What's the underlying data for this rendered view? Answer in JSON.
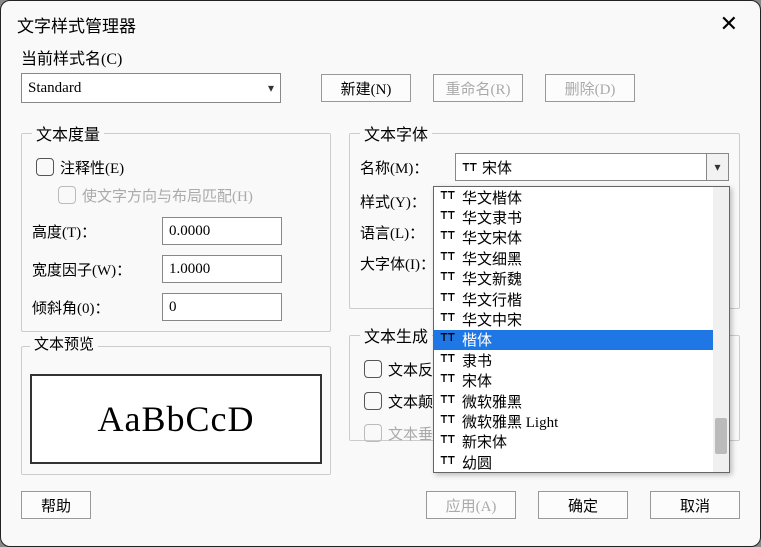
{
  "window": {
    "title": "文字样式管理器"
  },
  "currentStyle": {
    "label": "当前样式名(C)",
    "value": "Standard"
  },
  "topButtons": {
    "new": "新建(N)",
    "rename": "重命名(R)",
    "delete": "删除(D)"
  },
  "metrics": {
    "legend": "文本度量",
    "annotative": "注释性(E)",
    "matchOrientation": "使文字方向与布局匹配(H)",
    "heightLabel": "高度(T)：",
    "heightValue": "0.0000",
    "widthLabel": "宽度因子(W)：",
    "widthValue": "1.0000",
    "obliqueLabel": "倾斜角(0)：",
    "obliqueValue": "0"
  },
  "font": {
    "legend": "文本字体",
    "nameLabel": "名称(M)：",
    "nameValue": "宋体",
    "styleLabel": "样式(Y)：",
    "langLabel": "语言(L)：",
    "bigFontLabel": "大字体(I)："
  },
  "preview": {
    "legend": "文本预览",
    "sample": "AaBbCcD"
  },
  "gen": {
    "legend": "文本生成",
    "backwards": "文本反向",
    "upsidedown": "文本颠倒",
    "vertical": "文本垂直"
  },
  "footer": {
    "help": "帮助",
    "apply": "应用(A)",
    "ok": "确定",
    "cancel": "取消"
  },
  "fontList": [
    "华文楷体",
    "华文隶书",
    "华文宋体",
    "华文细黑",
    "华文新魏",
    "华文行楷",
    "华文中宋",
    "楷体",
    "隶书",
    "宋体",
    "微软雅黑",
    "微软雅黑 Light",
    "新宋体",
    "幼圆"
  ],
  "fontListSelectedIndex": 7
}
